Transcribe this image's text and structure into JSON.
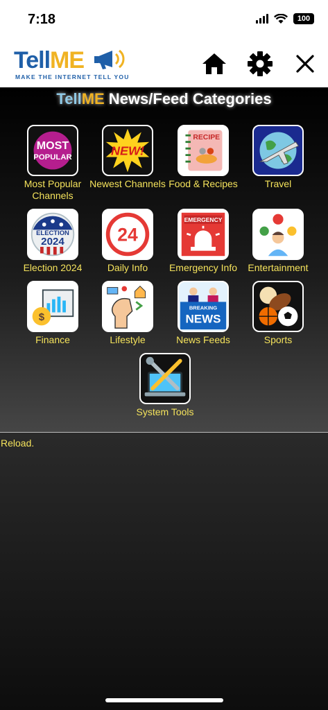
{
  "status_bar": {
    "time": "7:18",
    "battery": "100"
  },
  "header": {
    "logo": {
      "part1": "Tell",
      "part2": "ME",
      "tagline": "MAKE THE INTERNET TELL YOU"
    },
    "home_icon": "home-icon",
    "settings_icon": "gear-icon",
    "close_icon": "close-icon"
  },
  "page_title": {
    "brand1": "Tell",
    "brand2": "ME",
    "rest": " News/Feed Categories"
  },
  "categories": [
    {
      "label": "Most Popular Channels",
      "icon": "most-popular-icon"
    },
    {
      "label": "Newest Channels",
      "icon": "new-icon"
    },
    {
      "label": "Food & Recipes",
      "icon": "recipe-book-icon"
    },
    {
      "label": "Travel",
      "icon": "airplane-globe-icon"
    },
    {
      "label": "Election 2024",
      "icon": "election-badge-icon"
    },
    {
      "label": "Daily Info",
      "icon": "clock-24-icon"
    },
    {
      "label": "Emergency Info",
      "icon": "emergency-siren-icon"
    },
    {
      "label": "Entertainment",
      "icon": "entertainment-person-icon"
    },
    {
      "label": "Finance",
      "icon": "finance-chart-icon"
    },
    {
      "label": "Lifestyle",
      "icon": "lifestyle-head-icon"
    },
    {
      "label": "News Feeds",
      "icon": "breaking-news-icon"
    },
    {
      "label": "Sports",
      "icon": "sports-balls-icon"
    },
    {
      "label": "System Tools",
      "icon": "tools-laptop-icon"
    }
  ],
  "recipe_text": "RECIPE",
  "new_text": "NEW!",
  "most_popular_text": {
    "line1": "MOST",
    "line2": "POPULAR"
  },
  "election_text": {
    "line1": "ELECTION",
    "line2": "2024"
  },
  "daily_text": "24",
  "emergency_text": "EMERGENCY",
  "news_text": {
    "line1": "BREAKING",
    "line2": "NEWS"
  },
  "reload_text": "Reload.",
  "colors": {
    "label": "#f5e35c",
    "brand_blue": "#1f5fa8",
    "brand_gold": "#f0b323"
  }
}
